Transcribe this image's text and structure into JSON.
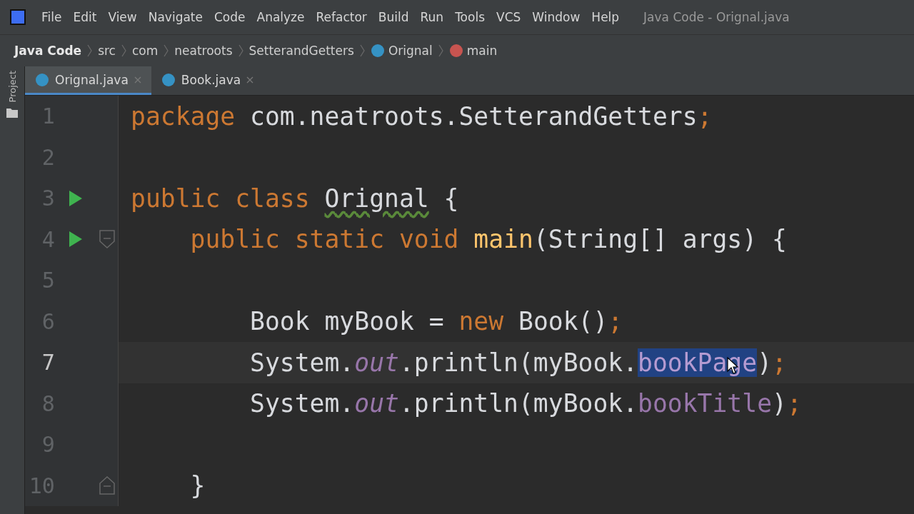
{
  "window": {
    "title": "Java Code - Orignal.java"
  },
  "menu": [
    "File",
    "Edit",
    "View",
    "Navigate",
    "Code",
    "Analyze",
    "Refactor",
    "Build",
    "Run",
    "Tools",
    "VCS",
    "Window",
    "Help"
  ],
  "breadcrumbs": [
    {
      "label": "Java Code",
      "kind": "project"
    },
    {
      "label": "src",
      "kind": "folder"
    },
    {
      "label": "com",
      "kind": "folder"
    },
    {
      "label": "neatroots",
      "kind": "folder"
    },
    {
      "label": "SetterandGetters",
      "kind": "folder"
    },
    {
      "label": "Orignal",
      "kind": "class"
    },
    {
      "label": "main",
      "kind": "method"
    }
  ],
  "tabs": [
    {
      "label": "Orignal.java",
      "selected": true
    },
    {
      "label": "Book.java",
      "selected": false
    }
  ],
  "sidebar": {
    "label": "Project"
  },
  "lines": [
    {
      "number": "1",
      "current": false,
      "tokens": [
        {
          "kind": "keyword",
          "text": "package"
        },
        {
          "kind": "plain",
          "text": " com.neatroots.SetterandGetters"
        },
        {
          "kind": "punct",
          "text": ";"
        }
      ]
    },
    {
      "number": "2",
      "current": false
    },
    {
      "number": "3",
      "current": false,
      "gutter": [
        {
          "kind": "run"
        }
      ],
      "tokens": [
        {
          "kind": "keyword",
          "text": "public class "
        },
        {
          "kind": "warned",
          "text": "Orignal"
        },
        {
          "kind": "plain",
          "text": " {"
        }
      ]
    },
    {
      "number": "4",
      "current": false,
      "gutter": [
        {
          "kind": "run"
        },
        {
          "kind": "fold_start"
        }
      ],
      "tokens": [
        {
          "kind": "keyword",
          "text": "    public static void "
        },
        {
          "kind": "method",
          "text": "main"
        },
        {
          "kind": "plain",
          "text": "(String[] args) {"
        }
      ]
    },
    {
      "number": "5",
      "current": false
    },
    {
      "number": "6",
      "current": false,
      "tokens": [
        {
          "kind": "plain",
          "text": "        Book myBook = "
        },
        {
          "kind": "keyword",
          "text": "new"
        },
        {
          "kind": "plain",
          "text": " Book()"
        },
        {
          "kind": "punct",
          "text": ";"
        }
      ]
    },
    {
      "number": "7",
      "current": true,
      "tokens": [
        {
          "kind": "plain",
          "text": "        System."
        },
        {
          "kind": "static",
          "text": "out"
        },
        {
          "kind": "plain",
          "text": ".println(myBook."
        },
        {
          "kind": "field_selected",
          "text": "bookPage"
        },
        {
          "kind": "plain",
          "text": ")"
        },
        {
          "kind": "punct",
          "text": ";"
        }
      ]
    },
    {
      "number": "8",
      "current": false,
      "tokens": [
        {
          "kind": "plain",
          "text": "        System."
        },
        {
          "kind": "static",
          "text": "out"
        },
        {
          "kind": "plain",
          "text": ".println(myBook."
        },
        {
          "kind": "field",
          "text": "bookTitle"
        },
        {
          "kind": "plain",
          "text": ")"
        },
        {
          "kind": "punct",
          "text": ";"
        }
      ]
    },
    {
      "number": "9",
      "current": false
    },
    {
      "number": "10",
      "current": false,
      "gutter": [
        {
          "kind": "fold_end"
        }
      ],
      "tokens": [
        {
          "kind": "plain",
          "text": "    }"
        }
      ]
    }
  ]
}
